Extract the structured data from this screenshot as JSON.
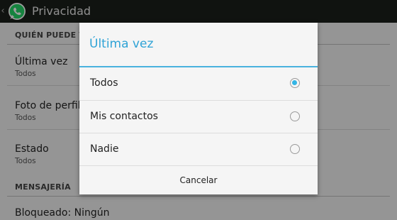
{
  "actionbar": {
    "title": "Privacidad"
  },
  "list": {
    "section1_header": "QUIÉN PUEDE VER",
    "items1": [
      {
        "title": "Última vez",
        "summary": "Todos"
      },
      {
        "title": "Foto de perfil",
        "summary": "Todos"
      },
      {
        "title": "Estado",
        "summary": "Todos"
      }
    ],
    "section2_header": "MENSAJERÍA",
    "items2": [
      {
        "title": "Bloqueado: Ningún"
      }
    ]
  },
  "dialog": {
    "title": "Última vez",
    "options": [
      {
        "label": "Todos",
        "selected": true
      },
      {
        "label": "Mis contactos",
        "selected": false
      },
      {
        "label": "Nadie",
        "selected": false
      }
    ],
    "cancel_label": "Cancelar"
  },
  "colors": {
    "accent": "#33b5e5",
    "actionbar": "#1a1f1a",
    "whatsapp_green": "#25d366"
  }
}
